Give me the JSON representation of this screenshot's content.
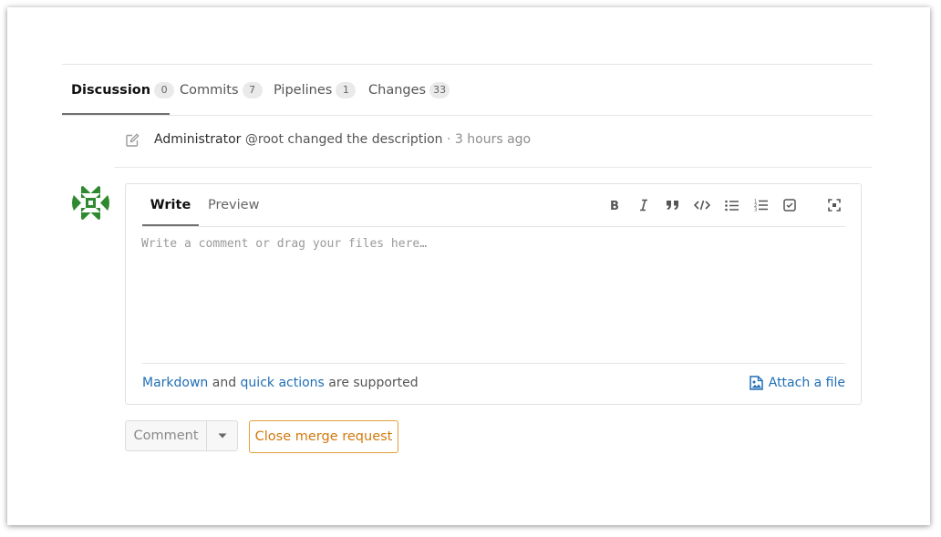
{
  "tabs": [
    {
      "label": "Discussion",
      "count": "0"
    },
    {
      "label": "Commits",
      "count": "7"
    },
    {
      "label": "Pipelines",
      "count": "1"
    },
    {
      "label": "Changes",
      "count": "33"
    }
  ],
  "system_note": {
    "author": "Administrator",
    "handle": "@root",
    "action": "changed the description",
    "time": "· 3 hours ago"
  },
  "editor": {
    "write_tab": "Write",
    "preview_tab": "Preview",
    "placeholder": "Write a comment or drag your files here…",
    "value": "",
    "toolbar_icons": [
      "bold-icon",
      "italic-icon",
      "quote-icon",
      "code-icon",
      "bullet-list-icon",
      "numbered-list-icon",
      "task-list-icon",
      "fullscreen-icon"
    ],
    "footer": {
      "markdown_link": "Markdown",
      "and": "and",
      "quick_actions_link": "quick actions",
      "suffix": "are supported"
    },
    "attach_label": "Attach a file"
  },
  "actions": {
    "comment_label": "Comment",
    "close_label": "Close merge request"
  },
  "colors": {
    "link": "#1f6fb5",
    "warning": "#d1790e",
    "avatar_green": "#2f8a2f"
  }
}
